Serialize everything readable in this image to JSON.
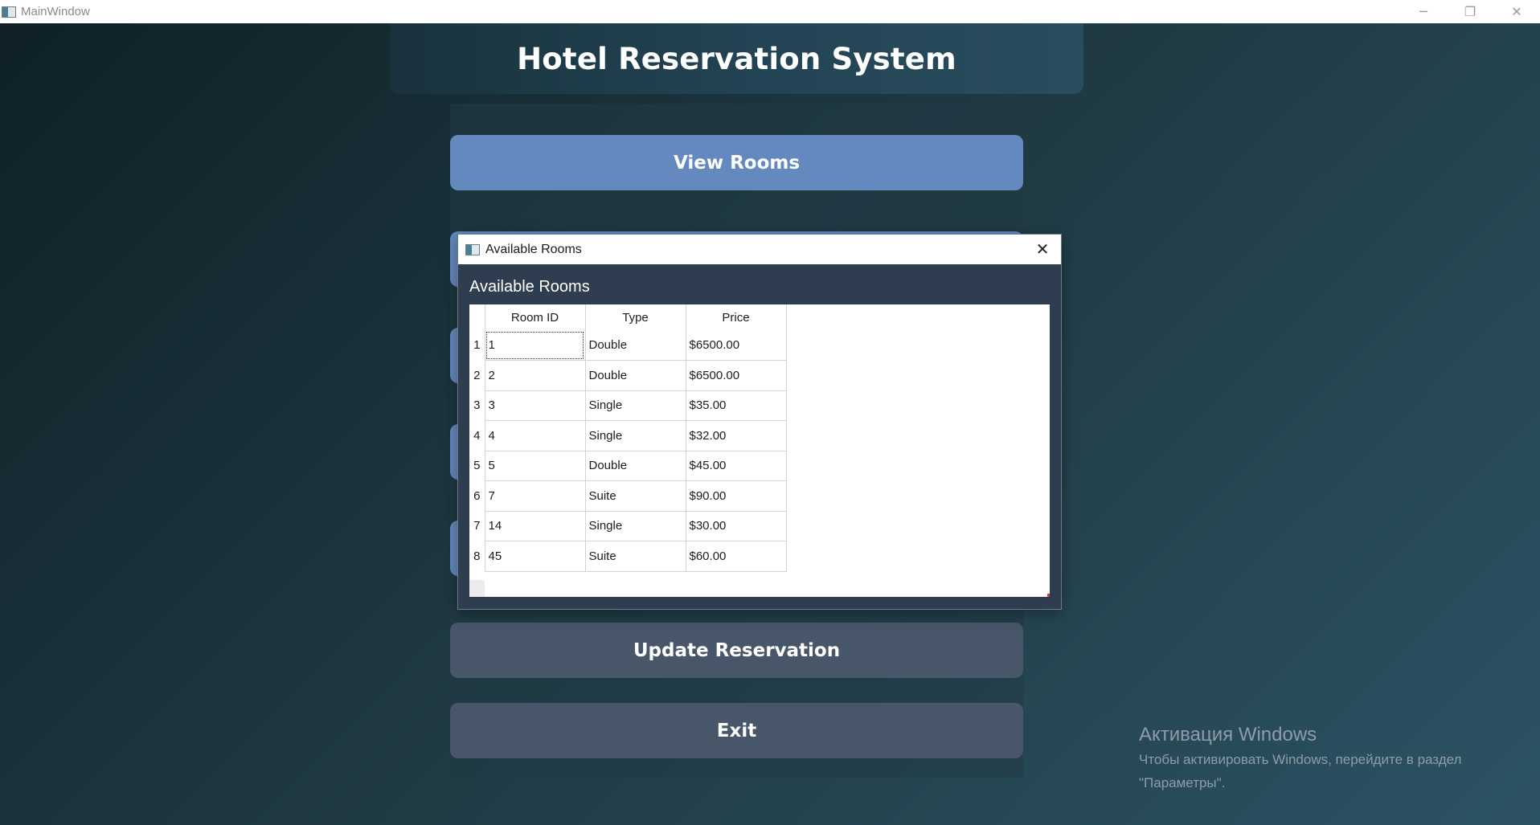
{
  "window": {
    "title": "MainWindow",
    "controls": {
      "minimize": "─",
      "restore": "❐",
      "close": "✕"
    }
  },
  "header": {
    "title": "Hotel Reservation System"
  },
  "buttons": {
    "view_rooms": "View Rooms",
    "update_reservation": "Update Reservation",
    "exit": "Exit"
  },
  "dialog": {
    "title": "Available Rooms",
    "heading": "Available Rooms",
    "close_glyph": "✕",
    "table": {
      "columns": [
        "Room ID",
        "Type",
        "Price"
      ],
      "rows": [
        {
          "num": "1",
          "room_id": "1",
          "type": "Double",
          "price": "$6500.00"
        },
        {
          "num": "2",
          "room_id": "2",
          "type": "Double",
          "price": "$6500.00"
        },
        {
          "num": "3",
          "room_id": "3",
          "type": "Single",
          "price": "$35.00"
        },
        {
          "num": "4",
          "room_id": "4",
          "type": "Single",
          "price": "$32.00"
        },
        {
          "num": "5",
          "room_id": "5",
          "type": "Double",
          "price": "$45.00"
        },
        {
          "num": "6",
          "room_id": "7",
          "type": "Suite",
          "price": "$90.00"
        },
        {
          "num": "7",
          "room_id": "14",
          "type": "Single",
          "price": "$30.00"
        },
        {
          "num": "8",
          "room_id": "45",
          "type": "Suite",
          "price": "$60.00"
        }
      ]
    }
  },
  "watermark": {
    "title": "Активация Windows",
    "line1": "Чтобы активировать Windows, перейдите в раздел",
    "line2": "\"Параметры\"."
  },
  "colors": {
    "primary_button": "#6389bf",
    "dark_button": "#485669",
    "dialog_bg": "#2e3d50"
  }
}
